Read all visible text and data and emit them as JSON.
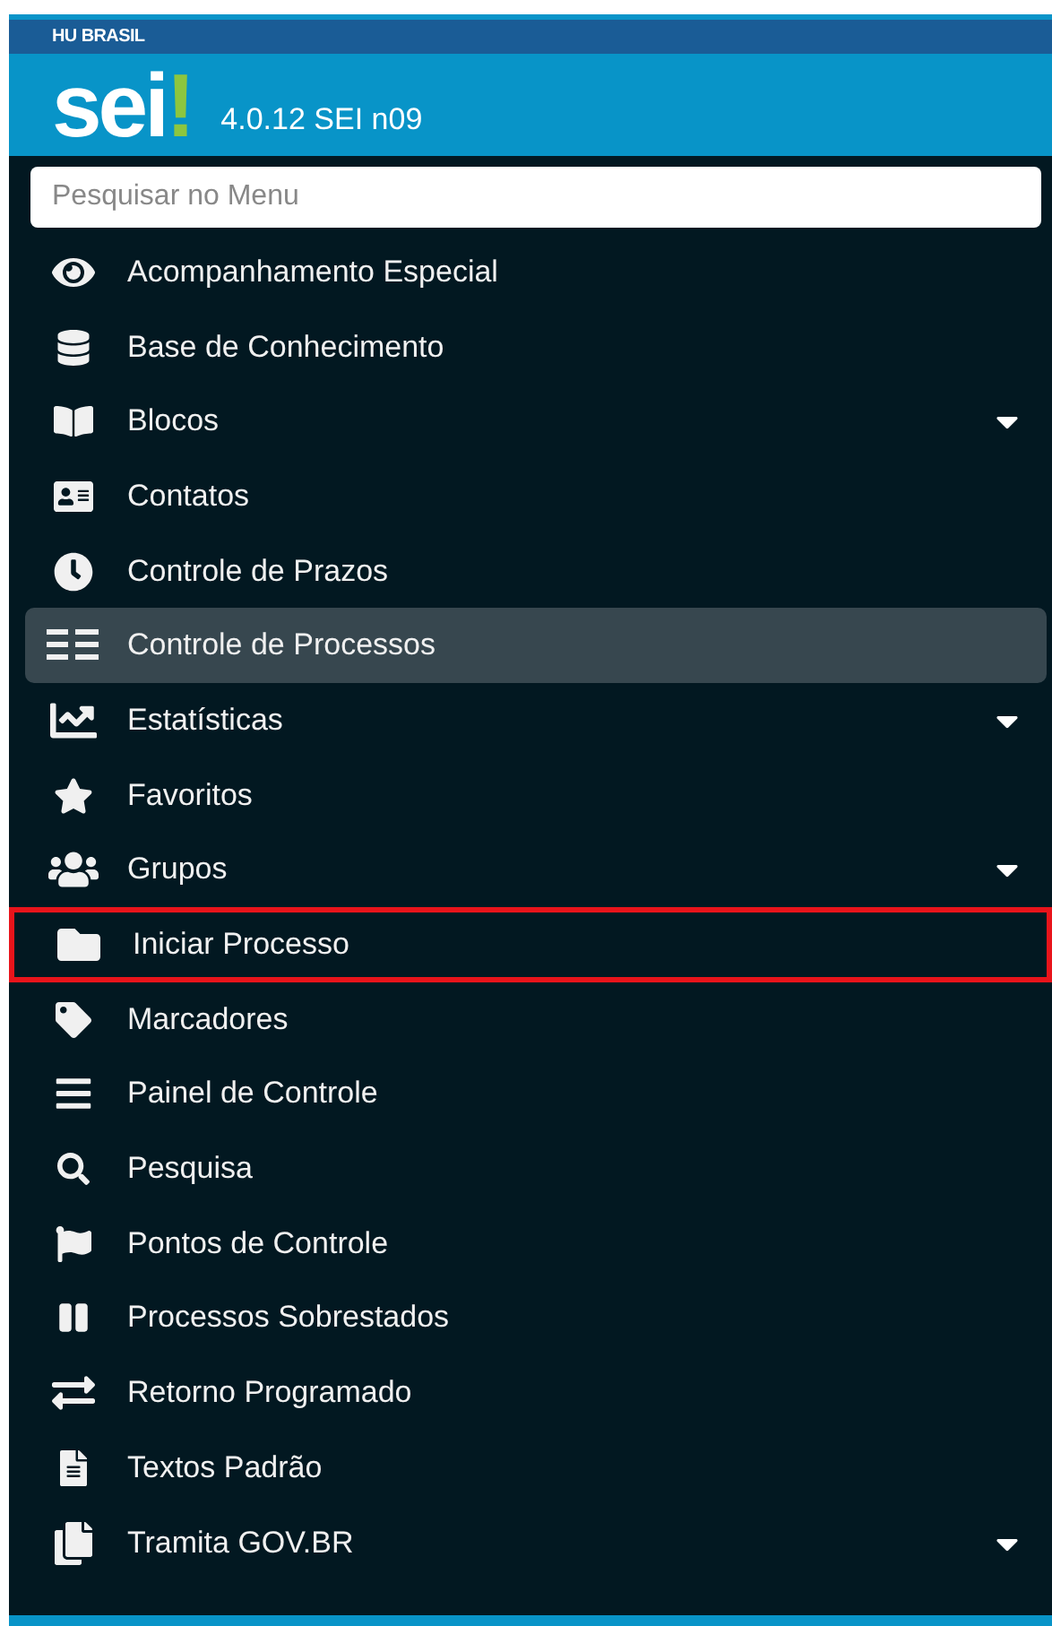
{
  "header": {
    "organization": "HU BRASIL",
    "logo": "sei!",
    "version": "4.0.12 SEI n09"
  },
  "search": {
    "placeholder": "Pesquisar no Menu"
  },
  "menu": [
    {
      "label": "Acompanhamento Especial",
      "selected": false,
      "expandable": false,
      "outlined": false
    },
    {
      "label": "Base de Conhecimento",
      "selected": false,
      "expandable": false,
      "outlined": false
    },
    {
      "label": "Blocos",
      "selected": false,
      "expandable": true,
      "outlined": false
    },
    {
      "label": "Contatos",
      "selected": false,
      "expandable": false,
      "outlined": false
    },
    {
      "label": "Controle de Prazos",
      "selected": false,
      "expandable": false,
      "outlined": false
    },
    {
      "label": "Controle de Processos",
      "selected": true,
      "expandable": false,
      "outlined": false
    },
    {
      "label": "Estatísticas",
      "selected": false,
      "expandable": true,
      "outlined": false
    },
    {
      "label": "Favoritos",
      "selected": false,
      "expandable": false,
      "outlined": false
    },
    {
      "label": "Grupos",
      "selected": false,
      "expandable": true,
      "outlined": false
    },
    {
      "label": "Iniciar Processo",
      "selected": false,
      "expandable": false,
      "outlined": true
    },
    {
      "label": "Marcadores",
      "selected": false,
      "expandable": false,
      "outlined": false
    },
    {
      "label": "Painel de Controle",
      "selected": false,
      "expandable": false,
      "outlined": false
    },
    {
      "label": "Pesquisa",
      "selected": false,
      "expandable": false,
      "outlined": false
    },
    {
      "label": "Pontos de Controle",
      "selected": false,
      "expandable": false,
      "outlined": false
    },
    {
      "label": "Processos Sobrestados",
      "selected": false,
      "expandable": false,
      "outlined": false
    },
    {
      "label": "Retorno Programado",
      "selected": false,
      "expandable": false,
      "outlined": false
    },
    {
      "label": "Textos Padrão",
      "selected": false,
      "expandable": false,
      "outlined": false
    },
    {
      "label": "Tramita GOV.BR",
      "selected": false,
      "expandable": true,
      "outlined": false
    }
  ]
}
